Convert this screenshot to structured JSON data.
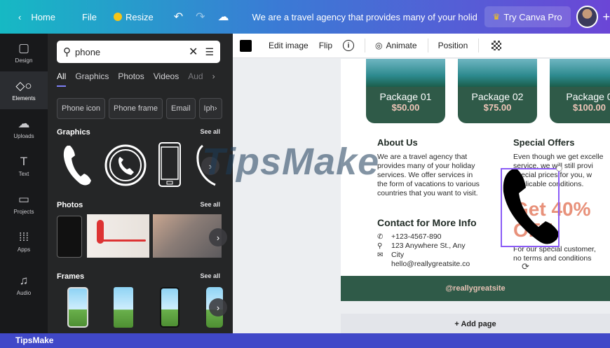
{
  "topbar": {
    "home": "Home",
    "file": "File",
    "resize": "Resize",
    "doc_title": "We are a travel agency that provides many of your holiday s...",
    "canva_pro": "Try Canva Pro",
    "plus": "+",
    "brand_color": "#6b46d6"
  },
  "rail": [
    {
      "label": "Design",
      "icon": "layout-icon",
      "glyph": "▢"
    },
    {
      "label": "Elements",
      "icon": "shapes-icon",
      "glyph": "◇○"
    },
    {
      "label": "Uploads",
      "icon": "cloud-upload-icon",
      "glyph": "☁"
    },
    {
      "label": "Text",
      "icon": "text-icon",
      "glyph": "T"
    },
    {
      "label": "Projects",
      "icon": "folder-icon",
      "glyph": "▭"
    },
    {
      "label": "Apps",
      "icon": "grid-icon",
      "glyph": "⋮⋮⋮"
    },
    {
      "label": "Audio",
      "icon": "music-icon",
      "glyph": "♫"
    }
  ],
  "panel": {
    "search_value": "phone",
    "tabs": [
      "All",
      "Graphics",
      "Photos",
      "Videos",
      "Aud"
    ],
    "chips": [
      "Phone icon",
      "Phone frame",
      "Email",
      "Iph"
    ],
    "graphics_title": "Graphics",
    "photos_title": "Photos",
    "frames_title": "Frames",
    "see_all": "See all"
  },
  "toolbar": {
    "edit_image": "Edit image",
    "flip": "Flip",
    "info": "i",
    "animate": "Animate",
    "position": "Position"
  },
  "design": {
    "packages": [
      {
        "name": "Package 01",
        "price": "$50.00"
      },
      {
        "name": "Package 02",
        "price": "$75.00"
      },
      {
        "name": "Package 0",
        "price": "$100.00"
      }
    ],
    "about_title": "About Us",
    "about_text": "We are a travel agency that provides many of your holiday services. We offer services in the form of vacations to various countries that you want to visit.",
    "offers_title": "Special Offers",
    "offers_text": [
      "Even though we get excelle",
      "service, we will still provi",
      "special prices for you, w",
      "applicable conditions."
    ],
    "get40": [
      "Get 40%",
      "OFF"
    ],
    "get40_sub": [
      "For our special customer,",
      "no terms and conditions"
    ],
    "contact_title": "Contact for More Info",
    "contacts": [
      {
        "icon": "phone-small-icon",
        "glyph": "✆",
        "text": "+123-4567-890"
      },
      {
        "icon": "location-icon",
        "glyph": "⚲",
        "text": "123 Anywhere St., Any"
      },
      {
        "icon": "mail-icon",
        "glyph": "✉",
        "text": "City"
      },
      {
        "icon": "",
        "glyph": "",
        "text": "hello@reallygreatsite.co"
      }
    ],
    "footer": "@reallygreatsite",
    "accent": "#2f5a48",
    "highlight": "#e8917a"
  },
  "add_page": "+ Add page",
  "watermark": "TipsMake",
  "bottom_brand": "TipsMake"
}
